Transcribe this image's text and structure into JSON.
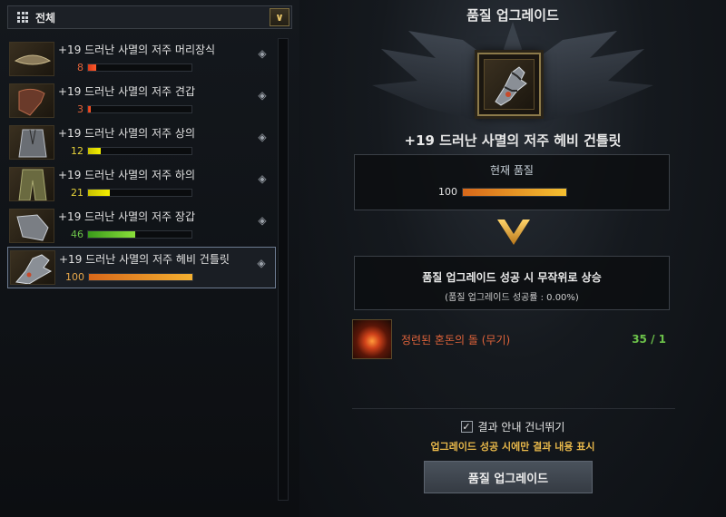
{
  "filter": {
    "label": "전체"
  },
  "items": [
    {
      "name": "+19 드러난 사멸의 저주 머리장식",
      "quality": 8,
      "num_color": "#e0633a",
      "fill": "linear-gradient(90deg,#d83a1a,#ff5a2a)"
    },
    {
      "name": "+19 드러난 사멸의 저주 견갑",
      "quality": 3,
      "num_color": "#e0633a",
      "fill": "linear-gradient(90deg,#d83a1a,#ff5a2a)"
    },
    {
      "name": "+19 드러난 사멸의 저주 상의",
      "quality": 12,
      "num_color": "#e6d23a",
      "fill": "linear-gradient(90deg,#c8c000,#f4f000)"
    },
    {
      "name": "+19 드러난 사멸의 저주 하의",
      "quality": 21,
      "num_color": "#e6d23a",
      "fill": "linear-gradient(90deg,#c8c000,#f4f000)"
    },
    {
      "name": "+19 드러난 사멸의 저주 장갑",
      "quality": 46,
      "num_color": "#6cc24a",
      "fill": "linear-gradient(90deg,#3a9a1a,#8ae03a)"
    },
    {
      "name": "+19 드러난 사멸의 저주 헤비 건틀릿",
      "quality": 100,
      "num_color": "#e8a84a",
      "fill": "linear-gradient(90deg,#d8681a,#f4b030)",
      "selected": true
    }
  ],
  "panel": {
    "title": "품질 업그레이드",
    "item_title": "+19 드러난 사멸의 저주 헤비 건틀릿",
    "current_label": "현재 품질",
    "current_quality": 100,
    "upgrade_line1": "품질 업그레이드 성공 시 무작위로 상승",
    "upgrade_line2": "(품질 업그레이드 성공률 : 0.00%)",
    "material_name": "정련된 혼돈의 돌 (무기)",
    "material_count": "35 / 1",
    "skip_label": "결과 안내 건너뛰기",
    "skip_note": "업그레이드 성공 시에만 결과 내용 표시",
    "button_label": "품질 업그레이드"
  },
  "icons": {
    "filter": "grid-icon",
    "dropdown": "chevron-down-icon",
    "gem": "gem-icon",
    "arrow": "chevron-down-arrow-icon",
    "check": "checkmark-icon"
  }
}
